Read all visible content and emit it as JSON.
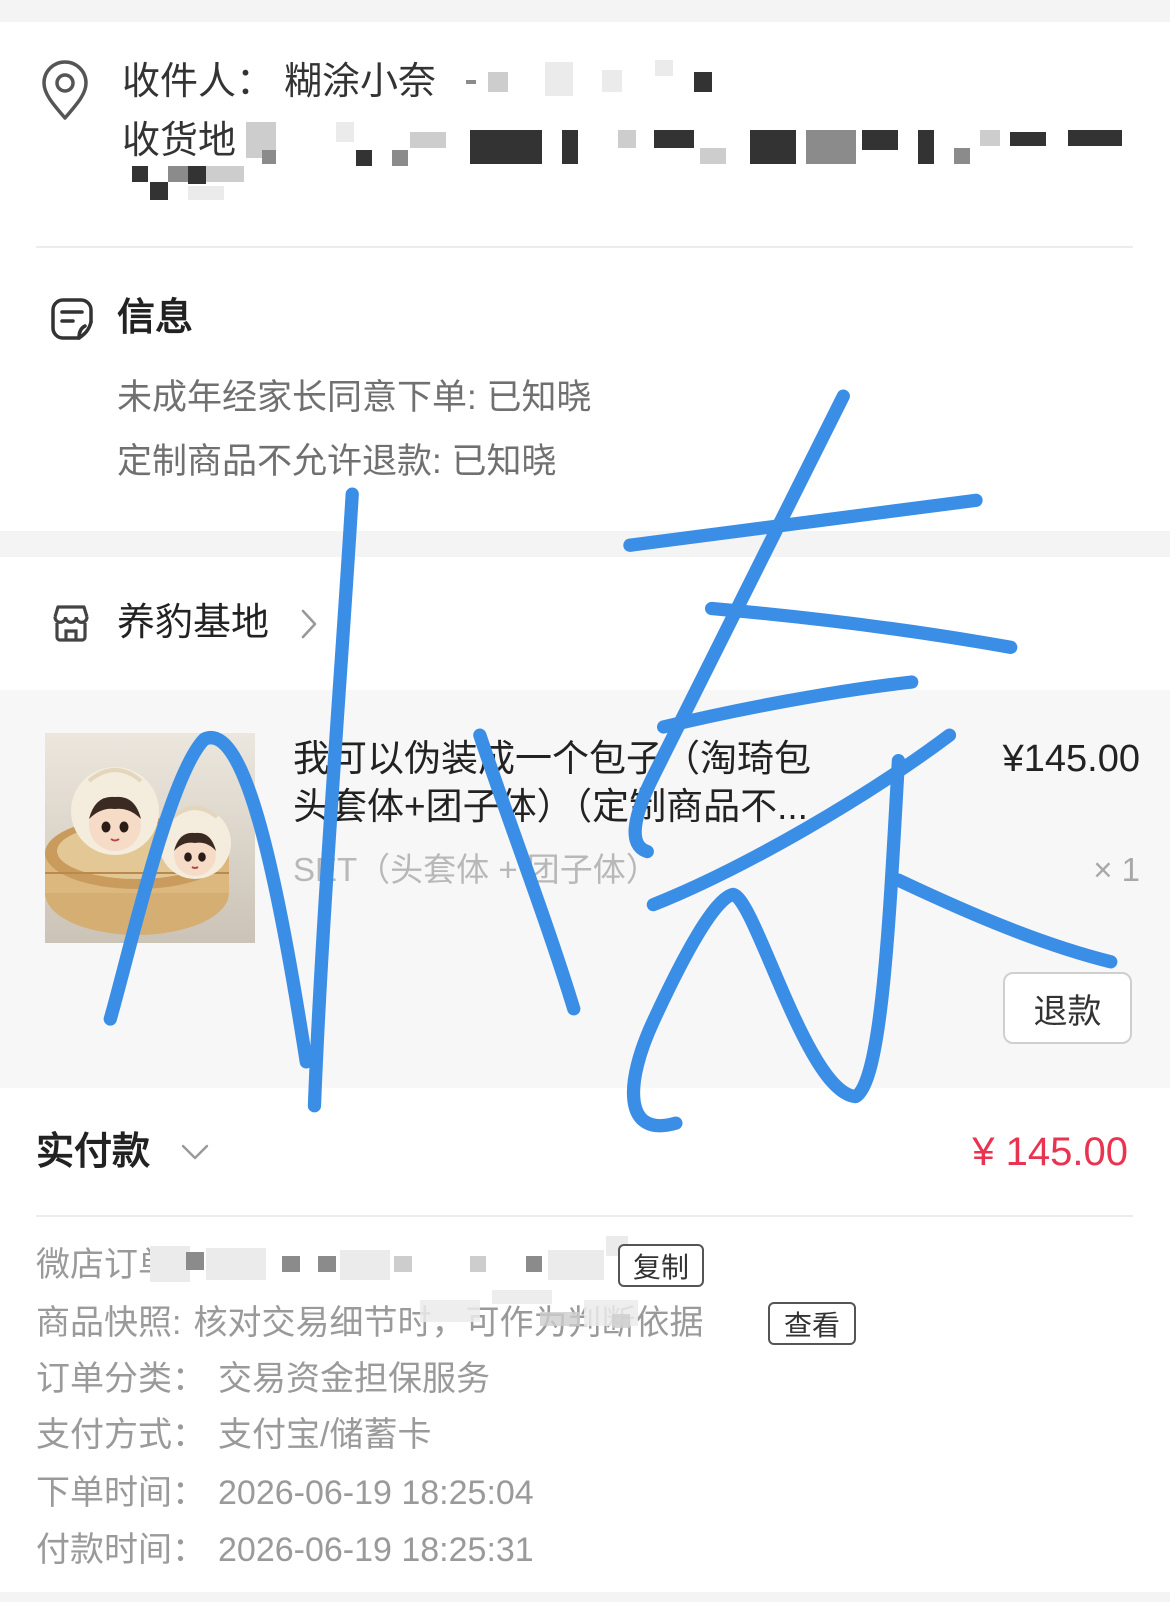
{
  "colors": {
    "accent_red": "#ea3350",
    "handwriting_blue": "#3b8ee6",
    "page_gray": "#f4f4f4",
    "card_gray": "#f7f7f7"
  },
  "icons": {
    "address": "location-pin-icon",
    "info": "message-icon",
    "shop": "store-icon",
    "shop_arrow": "chevron-right-icon",
    "payment_toggle": "chevron-down-icon"
  },
  "address": {
    "recipient_label": "收件人：",
    "recipient_name": "糊涂小奈",
    "address_label": "收货地"
  },
  "info": {
    "title": "信息",
    "lines": [
      "未成年经家长同意下单: 已知晓",
      "定制商品不允许退款: 已知晓"
    ]
  },
  "shop": {
    "name": "养豹基地"
  },
  "product": {
    "title": "我可以伪装成一个包子（淘琦包头套体+团子体）（定制商品不...",
    "price": "¥145.00",
    "spec": "SET（头套体 + 团子体）",
    "quantity": "× 1",
    "refund_label": "退款"
  },
  "payment": {
    "label": "实付款",
    "amount": "¥ 145.00"
  },
  "details": {
    "order_no_label": "微店订单",
    "copy_label": "复制",
    "snapshot_label": "商品快照:",
    "snapshot_value": "核对交易细节时，可作为判断依据",
    "view_label": "查看",
    "rows": [
      {
        "label": "订单分类：",
        "value": "交易资金担保服务"
      },
      {
        "label": "支付方式：",
        "value": "支付宝/储蓄卡"
      },
      {
        "label": "下单时间：",
        "value": "2026-06-19 18:25:04"
      },
      {
        "label": "付款时间：",
        "value": "2026-06-19 18:25:31"
      }
    ]
  },
  "handwriting": {
    "text": "小奈"
  }
}
